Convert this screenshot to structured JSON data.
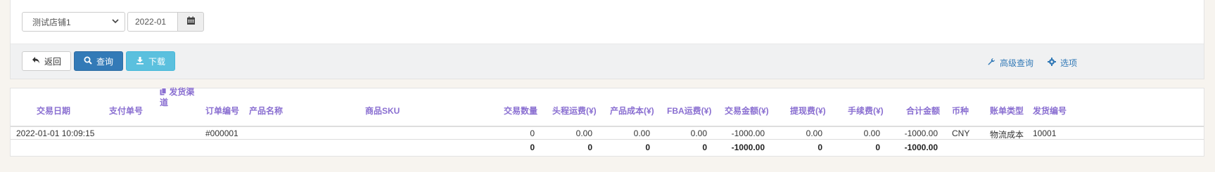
{
  "filters": {
    "store_select": "测试店铺1",
    "month_value": "2022-01"
  },
  "toolbar": {
    "back_label": "返回",
    "query_label": "查询",
    "download_label": "下载",
    "advanced_query_label": "高级查询",
    "options_label": "选项"
  },
  "table": {
    "columns": {
      "trade_date": "交易日期",
      "payment_no": "支付单号",
      "ship_channel": "发货渠道",
      "order_no": "订单编号",
      "product_name": "产品名称",
      "sku": "商品SKU",
      "quantity": "交易数量",
      "first_leg_fee": "头程运费(¥)",
      "product_cost": "产品成本(¥)",
      "fba_fee": "FBA运费(¥)",
      "trade_amount": "交易金额(¥)",
      "withdraw_fee": "提现费(¥)",
      "handling_fee": "手续费(¥)",
      "total_amount": "合计金额",
      "currency": "币种",
      "bill_type": "账单类型",
      "ship_no": "发货编号"
    },
    "rows": [
      {
        "trade_date": "2022-01-01 10:09:15",
        "payment_no": "",
        "ship_channel": "",
        "order_no": "#000001",
        "product_name": "",
        "sku": "",
        "quantity": "0",
        "first_leg_fee": "0.00",
        "product_cost": "0.00",
        "fba_fee": "0.00",
        "trade_amount": "-1000.00",
        "withdraw_fee": "0.00",
        "handling_fee": "0.00",
        "total_amount": "-1000.00",
        "currency": "CNY",
        "bill_type": "物流成本",
        "ship_no": "10001"
      }
    ],
    "footer": {
      "quantity": "0",
      "first_leg_fee": "0",
      "product_cost": "0",
      "fba_fee": "0",
      "trade_amount": "-1000.00",
      "withdraw_fee": "0",
      "handling_fee": "0",
      "total_amount": "-1000.00"
    }
  },
  "icons": {
    "select": "chevron-down-icon",
    "date": "calendar-icon",
    "back": "undo-icon",
    "query": "search-icon",
    "download": "download-icon",
    "advanced": "wrench-icon",
    "options": "gear-icon",
    "channel": "copy-icon"
  },
  "colors": {
    "primary": "#337ab7",
    "info": "#5bc0de",
    "header_text": "#8a6fd1"
  }
}
